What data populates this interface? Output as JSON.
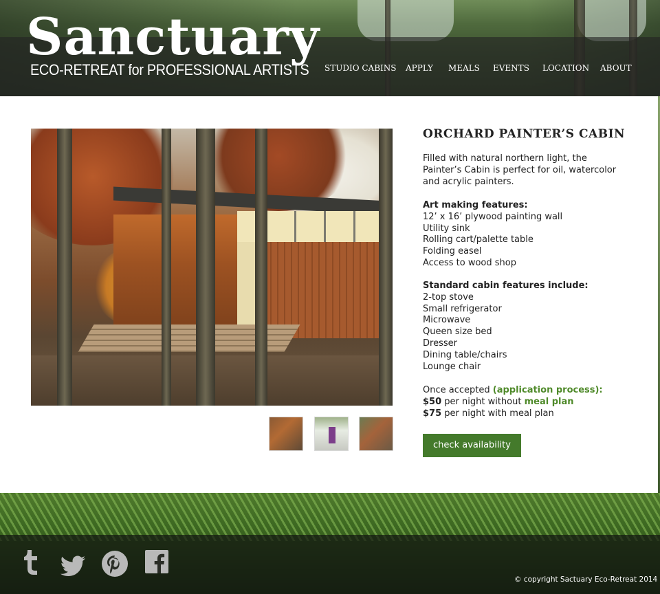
{
  "brand": {
    "name": "Sanctuary",
    "tagline": "ECO-RETREAT for PROFESSIONAL ARTISTS"
  },
  "nav": {
    "items": [
      {
        "label": "STUDIO CABINS"
      },
      {
        "label": "APPLY"
      },
      {
        "label": "MEALS"
      },
      {
        "label": "EVENTS"
      },
      {
        "label": "LOCATION"
      },
      {
        "label": "ABOUT"
      }
    ]
  },
  "cabin": {
    "title_pre": "ORCHARD ",
    "title_strong": "PAINTER’S",
    "title_post": " CABIN",
    "intro": "Filled with natural northern light, the Painter’s Cabin is perfect for oil, watercolor and acrylic painters.",
    "art_heading": "Art making features:",
    "art_features": [
      "12’ x 16’ plywood painting wall",
      "Utility sink",
      "Rolling cart/palette table",
      "Folding easel",
      "Access to wood shop"
    ],
    "standard_heading": "Standard cabin features include:",
    "standard_features": [
      "2-top stove",
      "Small refrigerator",
      "Microwave",
      "Queen size bed",
      "Dresser",
      "Dining table/chairs",
      "Lounge chair"
    ],
    "pricing": {
      "accepted_text": "Once accepted ",
      "process_link": "(application process):",
      "price_without": "$50",
      "without_text": " per night without ",
      "meal_plan_link": "meal plan",
      "price_with": "$75",
      "with_text": " per night with meal plan"
    },
    "cta_label": "check availability"
  },
  "gallery": {
    "thumb_count_shown": 3
  },
  "footer": {
    "social": [
      "tumblr-icon",
      "twitter-icon",
      "pinterest-icon",
      "facebook-icon"
    ],
    "copyright": "© copyright Sactuary Eco-Retreat 2014"
  },
  "colors": {
    "accent_green": "#447a2b",
    "link_green": "#4f8a2a",
    "text": "#222222",
    "header_overlay": "#232323"
  }
}
